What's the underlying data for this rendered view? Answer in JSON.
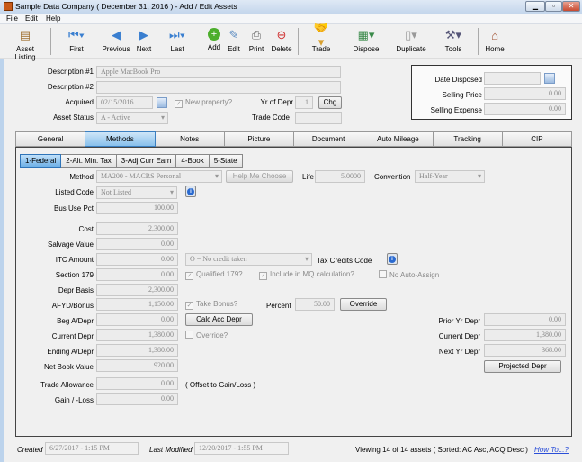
{
  "window": {
    "title": "Sample Data Company  ( December 31, 2016 ) - Add / Edit Assets",
    "minimize": "▁",
    "maximize": "▫",
    "close": "✕"
  },
  "menu": [
    "File",
    "Edit",
    "Help"
  ],
  "toolbar": [
    {
      "label": "Asset Listing",
      "icon": "ledger-icon"
    },
    {
      "label": "First",
      "icon": "first-icon"
    },
    {
      "label": "Previous",
      "icon": "previous-icon"
    },
    {
      "label": "Next",
      "icon": "next-icon"
    },
    {
      "label": "Last",
      "icon": "last-icon"
    },
    {
      "label": "Add",
      "icon": "add-icon"
    },
    {
      "label": "Edit",
      "icon": "edit-icon"
    },
    {
      "label": "Print",
      "icon": "print-icon"
    },
    {
      "label": "Delete",
      "icon": "delete-icon"
    },
    {
      "label": "Trade",
      "icon": "handshake-icon"
    },
    {
      "label": "Dispose",
      "icon": "money-icon"
    },
    {
      "label": "Duplicate",
      "icon": "document-icon"
    },
    {
      "label": "Tools",
      "icon": "tools-icon"
    },
    {
      "label": "Home",
      "icon": "home-icon"
    }
  ],
  "header": {
    "desc1_label": "Description #1",
    "desc1": "Apple MacBook Pro",
    "desc2_label": "Description #2",
    "desc2": "",
    "acquired_label": "Acquired",
    "acquired": "02/15/2016",
    "new_property": "New property?",
    "new_property_checked": true,
    "yr_label": "Yr of Depr",
    "yr": "1",
    "chg": "Chg",
    "status_label": "Asset Status",
    "status": "A - Active",
    "trade_code_label": "Trade Code",
    "trade_code": ""
  },
  "disposal": {
    "date_label": "Date Disposed",
    "date": "",
    "price_label": "Selling Price",
    "price": "0.00",
    "expense_label": "Selling Expense",
    "expense": "0.00"
  },
  "tabs": [
    "General",
    "Methods",
    "Notes",
    "Picture",
    "Document",
    "Auto Mileage",
    "Tracking",
    "CIP"
  ],
  "active_tab": "Methods",
  "subtabs": [
    "1-Federal",
    "2-Alt. Min. Tax",
    "3-Adj Curr Earn",
    "4-Book",
    "5-State"
  ],
  "active_subtab": "1-Federal",
  "methods": {
    "method_label": "Method",
    "method": "MA200 - MACRS Personal",
    "help": "Help Me Choose",
    "life_label": "Life",
    "life": "5.0000",
    "convention_label": "Convention",
    "convention": "Half-Year",
    "listed_label": "Listed Code",
    "listed": "Not Listed",
    "bus_label": "Bus Use Pct",
    "bus": "100.00",
    "cost_label": "Cost",
    "cost": "2,300.00",
    "salvage_label": "Salvage Value",
    "salvage": "0.00",
    "itc_label": "ITC Amount",
    "itc": "0.00",
    "itc_code": "O = No credit taken",
    "tax_credits_label": "Tax Credits Code",
    "s179_label": "Section 179",
    "s179": "0.00",
    "qualified": "Qualified 179?",
    "include_mq": "Include in MQ calculation?",
    "no_auto": "No Auto-Assign",
    "basis_label": "Depr Basis",
    "basis": "2,300.00",
    "afyd_label": "AFYD/Bonus",
    "afyd": "1,150.00",
    "take_bonus": "Take Bonus?",
    "percent_label": "Percent",
    "percent": "50.00",
    "override_btn": "Override",
    "beg_label": "Beg A/Depr",
    "beg": "0.00",
    "calc_btn": "Calc Acc Depr",
    "cur_label": "Current Depr",
    "cur": "1,380.00",
    "override_chk": "Override?",
    "end_label": "Ending A/Depr",
    "end": "1,380.00",
    "nbv_label": "Net Book Value",
    "nbv": "920.00",
    "trade_label": "Trade Allowance",
    "trade": "0.00",
    "offset": "( Offset to Gain/Loss )",
    "gain_label": "Gain / -Loss",
    "gain": "0.00",
    "prior_label": "Prior Yr Depr",
    "prior": "0.00",
    "cur2_label": "Current Depr",
    "cur2": "1,380.00",
    "next_label": "Next Yr Depr",
    "next": "368.00",
    "projected_btn": "Projected Depr"
  },
  "footer": {
    "created_label": "Created",
    "created": "6/27/2017 - 1:15 PM",
    "modified_label": "Last Modified",
    "modified": "12/20/2017 - 1:55 PM",
    "viewing": "Viewing 14 of 14 assets  ( Sorted:  AC Asc, ACQ Desc )",
    "howto": "How To...?"
  }
}
